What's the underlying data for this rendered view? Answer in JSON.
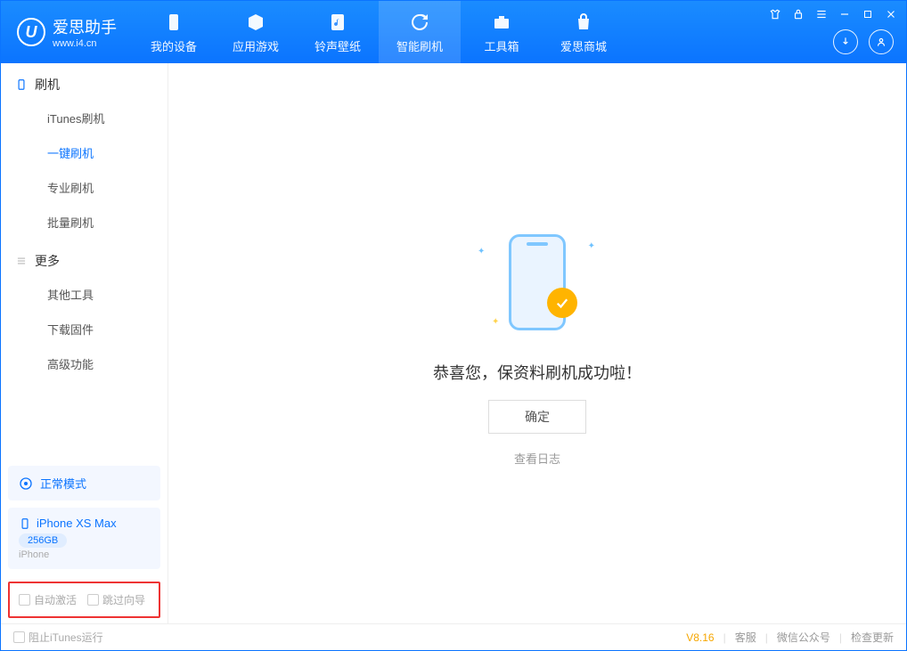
{
  "brand": {
    "name": "爱思助手",
    "url": "www.i4.cn"
  },
  "nav": {
    "tabs": [
      {
        "label": "我的设备",
        "icon": "phone"
      },
      {
        "label": "应用游戏",
        "icon": "cube"
      },
      {
        "label": "铃声壁纸",
        "icon": "music"
      },
      {
        "label": "智能刷机",
        "icon": "refresh",
        "active": true
      },
      {
        "label": "工具箱",
        "icon": "toolbox"
      },
      {
        "label": "爱思商城",
        "icon": "bag"
      }
    ]
  },
  "sidebar": {
    "sections": [
      {
        "title": "刷机",
        "items": [
          "iTunes刷机",
          "一键刷机",
          "专业刷机",
          "批量刷机"
        ],
        "activeIndex": 1
      },
      {
        "title": "更多",
        "items": [
          "其他工具",
          "下载固件",
          "高级功能"
        ]
      }
    ],
    "mode_label": "正常模式",
    "device": {
      "name": "iPhone XS Max",
      "storage": "256GB",
      "type": "iPhone"
    },
    "checkboxes": {
      "auto_activate": "自动激活",
      "skip_guide": "跳过向导"
    }
  },
  "main": {
    "success_title": "恭喜您，保资料刷机成功啦！",
    "ok_label": "确定",
    "log_link": "查看日志"
  },
  "statusbar": {
    "block_itunes": "阻止iTunes运行",
    "version": "V8.16",
    "links": [
      "客服",
      "微信公众号",
      "检查更新"
    ]
  }
}
